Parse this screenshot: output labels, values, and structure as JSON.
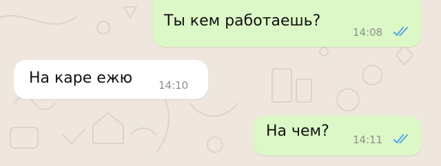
{
  "chat": {
    "messages": [
      {
        "direction": "outgoing",
        "text": "Ты кем работаешь?",
        "time": "14:08",
        "status": "read"
      },
      {
        "direction": "incoming",
        "text": "На каре ежю",
        "time": "14:10"
      },
      {
        "direction": "outgoing",
        "text": "На чем?",
        "time": "14:11",
        "status": "read"
      }
    ]
  },
  "colors": {
    "background": "#efe7de",
    "outgoing_bubble": "#dcf8c6",
    "incoming_bubble": "#ffffff",
    "read_ticks": "#4fa3e6",
    "timestamp": "#8a8f91"
  },
  "icons": {
    "read_status": "double-check-icon"
  }
}
